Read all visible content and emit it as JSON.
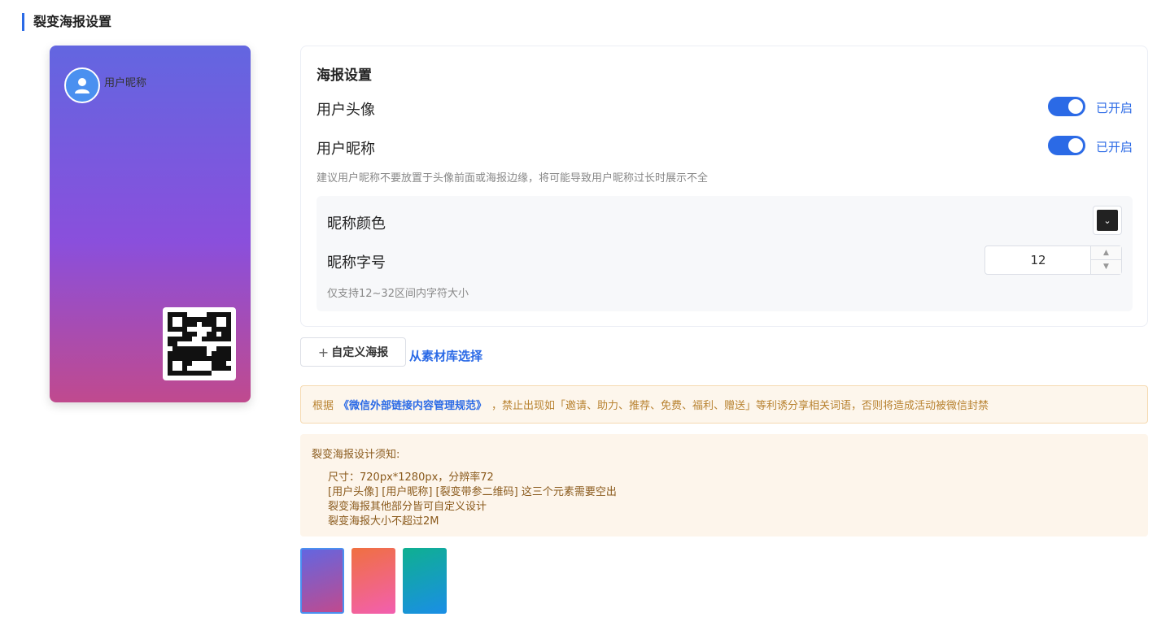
{
  "section_title": "裂变海报设置",
  "poster": {
    "nickname": "用户昵称",
    "gradient_colors": [
      "#6366e0",
      "#8a4fdc",
      "#c04a8e"
    ]
  },
  "settings": {
    "title": "海报设置",
    "avatar_label": "用户头像",
    "avatar_status": "已开启",
    "nickname_label": "用户昵称",
    "nickname_status": "已开启",
    "hint": "建议用户昵称不要放置于头像前面或海报边缘，将可能导致用户昵称过长时展示不全",
    "color_label": "昵称颜色",
    "color_value": "#222222",
    "size_label": "昵称字号",
    "size_value": "12",
    "size_hint": "仅支持12~32区间内字符大小"
  },
  "buttons": {
    "custom_poster": "自定义海报",
    "from_library": "从素材库选择"
  },
  "notice": {
    "prefix": "根据",
    "link": "《微信外部链接内容管理规范》",
    "suffix": "，禁止出现如「邀请、助力、推荐、免费、福利、赠送」等利诱分享相关词语，否则将造成活动被微信封禁"
  },
  "tips": {
    "title": "裂变海报设计须知:",
    "lines": [
      "尺寸：720px*1280px，分辨率72",
      "[用户头像] [用户昵称] [裂变带参二维码] 这三个元素需要空出",
      "裂变海报其他部分皆可自定义设计",
      "裂变海报大小不超过2M"
    ]
  },
  "templates": [
    {
      "name": "template-purple",
      "gradient": [
        "#6366e0",
        "#c04a8e"
      ],
      "selected": true
    },
    {
      "name": "template-orange",
      "gradient": [
        "#f07040",
        "#f25fb0"
      ],
      "selected": false
    },
    {
      "name": "template-teal",
      "gradient": [
        "#0fb090",
        "#1a8ee6"
      ],
      "selected": false
    }
  ],
  "accent_color": "#2b6ae6"
}
